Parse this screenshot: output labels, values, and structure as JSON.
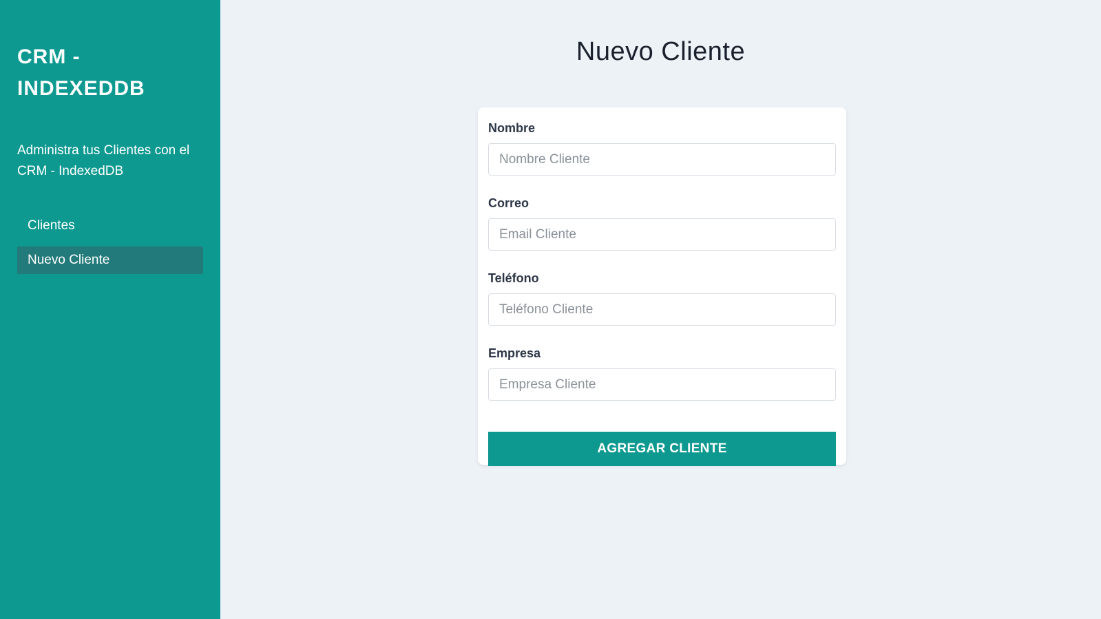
{
  "sidebar": {
    "brand_line1": "CRM -",
    "brand_line2": "INDEXEDDB",
    "tagline": "Administra tus Clientes con el CRM - IndexedDB",
    "items": [
      {
        "label": "Clientes",
        "active": false
      },
      {
        "label": "Nuevo Cliente",
        "active": true
      }
    ]
  },
  "main": {
    "title": "Nuevo Cliente",
    "form": {
      "fields": [
        {
          "label": "Nombre",
          "placeholder": "Nombre Cliente",
          "value": ""
        },
        {
          "label": "Correo",
          "placeholder": "Email Cliente",
          "value": ""
        },
        {
          "label": "Teléfono",
          "placeholder": "Teléfono Cliente",
          "value": ""
        },
        {
          "label": "Empresa",
          "placeholder": "Empresa Cliente",
          "value": ""
        }
      ],
      "submit_label": "AGREGAR CLIENTE"
    }
  },
  "colors": {
    "accent": "#0e9990",
    "nav_active": "#237a7a",
    "background": "#edf2f7"
  }
}
